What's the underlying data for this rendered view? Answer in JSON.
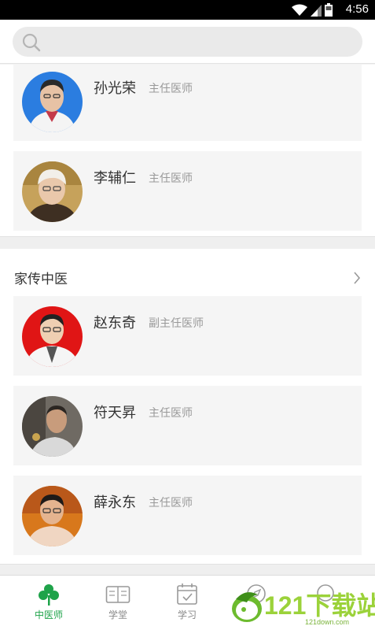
{
  "status_bar": {
    "time": "4:56"
  },
  "search": {
    "placeholder": ""
  },
  "sections": [
    {
      "doctors": [
        {
          "name": "孙光荣",
          "title": "主任医师"
        },
        {
          "name": "李辅仁",
          "title": "主任医师"
        }
      ]
    },
    {
      "title": "家传中医",
      "doctors": [
        {
          "name": "赵东奇",
          "title": "副主任医师"
        },
        {
          "name": "符天昇",
          "title": "主任医师"
        },
        {
          "name": "薛永东",
          "title": "主任医师"
        }
      ]
    }
  ],
  "bottom_nav": [
    {
      "label": "中医师",
      "icon": "clover-icon",
      "active": true
    },
    {
      "label": "学堂",
      "icon": "book-icon",
      "active": false
    },
    {
      "label": "学习",
      "icon": "calendar-check-icon",
      "active": false
    },
    {
      "label": "",
      "icon": "compass-icon",
      "active": false
    },
    {
      "label": "",
      "icon": "chat-icon",
      "active": false
    }
  ],
  "watermark": {
    "text": "121下载站",
    "sub": "121down.com"
  },
  "colors": {
    "accent": "#1fa34a",
    "status_bar": "#000000",
    "card_bg": "#f5f5f5"
  }
}
